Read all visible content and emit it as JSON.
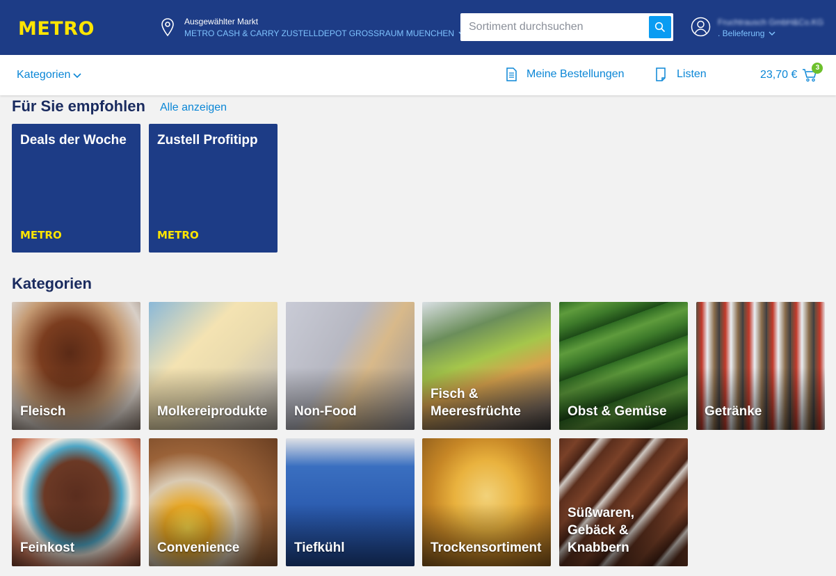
{
  "header": {
    "logo": "METRO",
    "market_label": "Ausgewählter Markt",
    "market_name": "METRO CASH & CARRY ZUSTELLDEPOT GROSSRAUM MUENCHEN",
    "search_placeholder": "Sortiment durchsuchen",
    "user_name": "Fruchtrausch GmbH&Co.KG",
    "user_sub": ". Belieferung"
  },
  "nav": {
    "categories": "Kategorien",
    "orders": "Meine Bestellungen",
    "lists": "Listen",
    "cart_total": "23,70 €",
    "cart_count": "3"
  },
  "recommended": {
    "title": "Für Sie empfohlen",
    "show_all": "Alle anzeigen",
    "cards": [
      {
        "title": "Deals der Woche",
        "logo": "METRO"
      },
      {
        "title": "Zustell Profitipp",
        "logo": "METRO"
      }
    ]
  },
  "categories": {
    "title": "Kategorien",
    "items": [
      {
        "label": "Fleisch"
      },
      {
        "label": "Molkereiprodukte"
      },
      {
        "label": "Non-Food"
      },
      {
        "label": "Fisch &\nMeeresfrüchte"
      },
      {
        "label": "Obst & Gemüse"
      },
      {
        "label": "Getränke"
      },
      {
        "label": "Feinkost"
      },
      {
        "label": "Convenience"
      },
      {
        "label": "Tiefkühl"
      },
      {
        "label": "Trockensortiment"
      },
      {
        "label": "Süßwaren,\nGebäck &\nKnabbern"
      }
    ]
  },
  "colors": {
    "header_bg": "#1d3c86",
    "logo_yellow": "#ffe500",
    "link_blue": "#0a86d6",
    "search_button": "#0a9cf2",
    "badge_green": "#6dc02c"
  }
}
